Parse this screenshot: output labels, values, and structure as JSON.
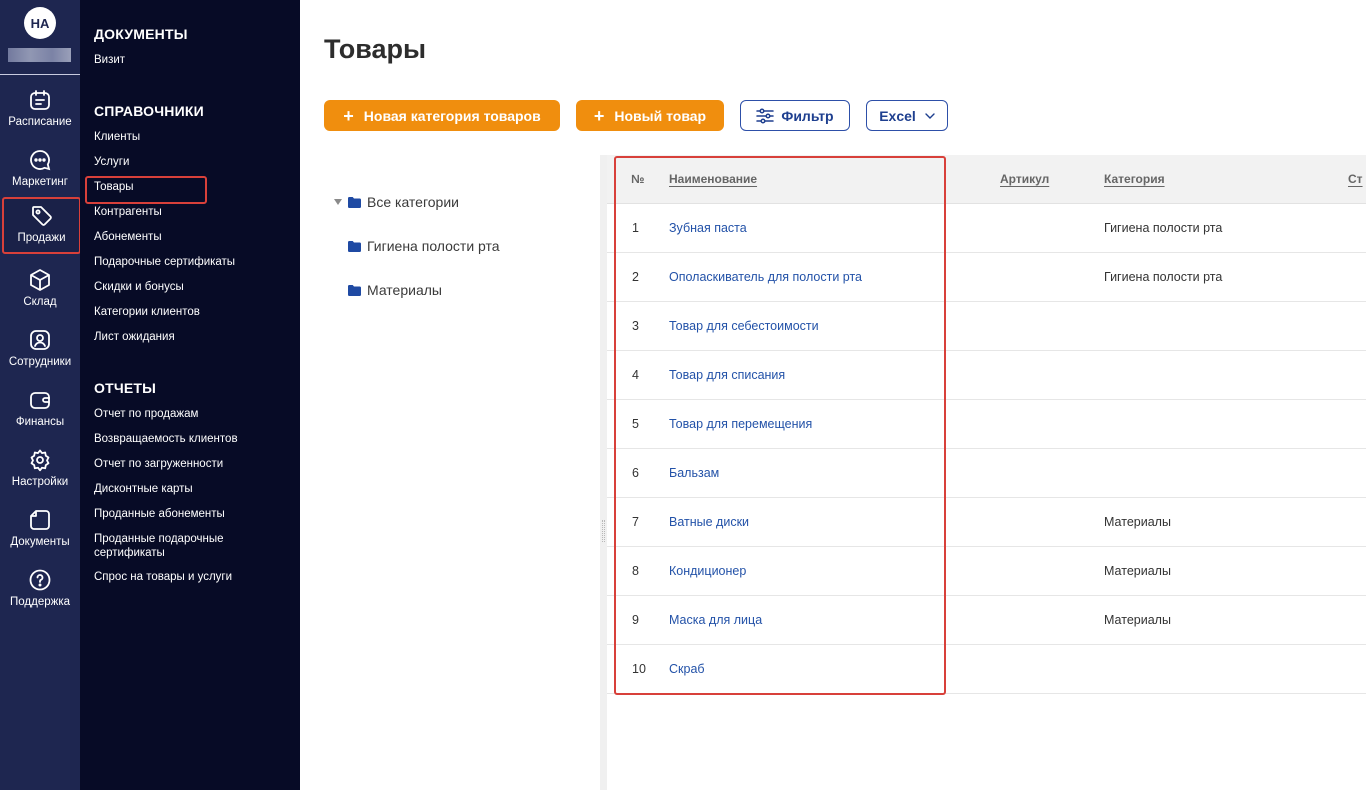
{
  "user": {
    "initials": "НА"
  },
  "rail": {
    "items": [
      {
        "label": "Расписание",
        "icon": "calendar-icon"
      },
      {
        "label": "Маркетинг",
        "icon": "chat-icon"
      },
      {
        "label": "Продажи",
        "icon": "tag-icon",
        "active": true
      },
      {
        "label": "Склад",
        "icon": "box-icon"
      },
      {
        "label": "Сотрудники",
        "icon": "user-icon"
      },
      {
        "label": "Финансы",
        "icon": "wallet-icon"
      },
      {
        "label": "Настройки",
        "icon": "gear-icon"
      },
      {
        "label": "Документы",
        "icon": "document-icon"
      },
      {
        "label": "Поддержка",
        "icon": "help-icon"
      }
    ]
  },
  "sidebar": {
    "documents": {
      "title": "ДОКУМЕНТЫ",
      "items": [
        "Визит"
      ]
    },
    "directories": {
      "title": "СПРАВОЧНИКИ",
      "items": [
        "Клиенты",
        "Услуги",
        "Товары",
        "Контрагенты",
        "Абонементы",
        "Подарочные сертификаты",
        "Скидки и бонусы",
        "Категории клиентов",
        "Лист ожидания"
      ]
    },
    "reports": {
      "title": "ОТЧЕТЫ",
      "items": [
        "Отчет по продажам",
        "Возвращаемость клиентов",
        "Отчет по загруженности",
        "Дисконтные карты",
        "Проданные абонементы",
        "Проданные подарочные сертификаты",
        "Спрос на товары и услуги"
      ]
    }
  },
  "page": {
    "title": "Товары"
  },
  "toolbar": {
    "new_category": "Новая категория товаров",
    "new_product": "Новый товар",
    "filter": "Фильтр",
    "export": "Excel",
    "plus": "+"
  },
  "tree": {
    "items": [
      "Все категории",
      "Гигиена полости рта",
      "Материалы"
    ]
  },
  "table": {
    "headers": {
      "num": "№",
      "name": "Наименование",
      "sku": "Артикул",
      "category": "Категория",
      "cut": "Ст"
    },
    "rows": [
      {
        "num": "1",
        "name": "Зубная паста",
        "category": "Гигиена полости рта"
      },
      {
        "num": "2",
        "name": "Ополаскиватель для полости рта",
        "category": "Гигиена полости рта"
      },
      {
        "num": "3",
        "name": "Товар для себестоимости",
        "category": ""
      },
      {
        "num": "4",
        "name": "Товар для списания",
        "category": ""
      },
      {
        "num": "5",
        "name": "Товар для перемещения",
        "category": ""
      },
      {
        "num": "6",
        "name": "Бальзам",
        "category": ""
      },
      {
        "num": "7",
        "name": "Ватные диски",
        "category": "Материалы"
      },
      {
        "num": "8",
        "name": "Кондиционер",
        "category": "Материалы"
      },
      {
        "num": "9",
        "name": "Маска для лица",
        "category": "Материалы"
      },
      {
        "num": "10",
        "name": "Скраб",
        "category": ""
      }
    ]
  },
  "colors": {
    "rail_bg": "#1e2650",
    "sidebar_bg": "#070b26",
    "accent_orange": "#f08e0e",
    "link_blue": "#2352a8",
    "highlight_red": "#d8403a"
  }
}
